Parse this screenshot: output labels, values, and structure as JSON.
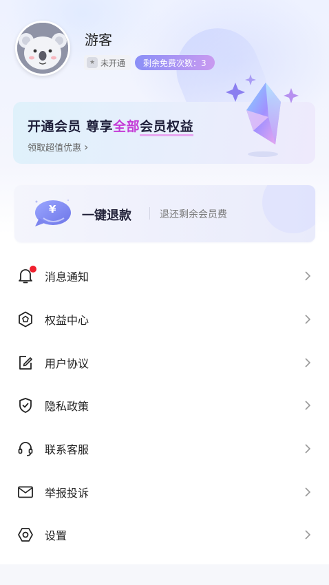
{
  "profile": {
    "username": "游客",
    "status_label": "未开通",
    "free_count_label": "剩余免费次数：3"
  },
  "vip": {
    "title_prefix": "开通会员 尊享",
    "title_highlight": "全部",
    "title_suffix": "会员权益",
    "subtitle": "领取超值优惠",
    "chevron": "›"
  },
  "refund": {
    "title": "一键退款",
    "description": "退还剩余会员费",
    "currency_symbol": "¥"
  },
  "menu": {
    "items": [
      {
        "label": "消息通知",
        "icon": "bell-icon",
        "has_dot": true
      },
      {
        "label": "权益中心",
        "icon": "hexagon-badge-icon"
      },
      {
        "label": "用户协议",
        "icon": "edit-document-icon"
      },
      {
        "label": "隐私政策",
        "icon": "shield-check-icon"
      },
      {
        "label": "联系客服",
        "icon": "headset-icon"
      },
      {
        "label": "举报投诉",
        "icon": "envelope-icon"
      },
      {
        "label": "设置",
        "icon": "settings-hexagon-icon"
      }
    ]
  },
  "colors": {
    "accent_purple": "#c43bd6",
    "badge_gradient_start": "#8a8ff7",
    "badge_gradient_end": "#c99af0",
    "notification_dot": "#f0202e"
  }
}
